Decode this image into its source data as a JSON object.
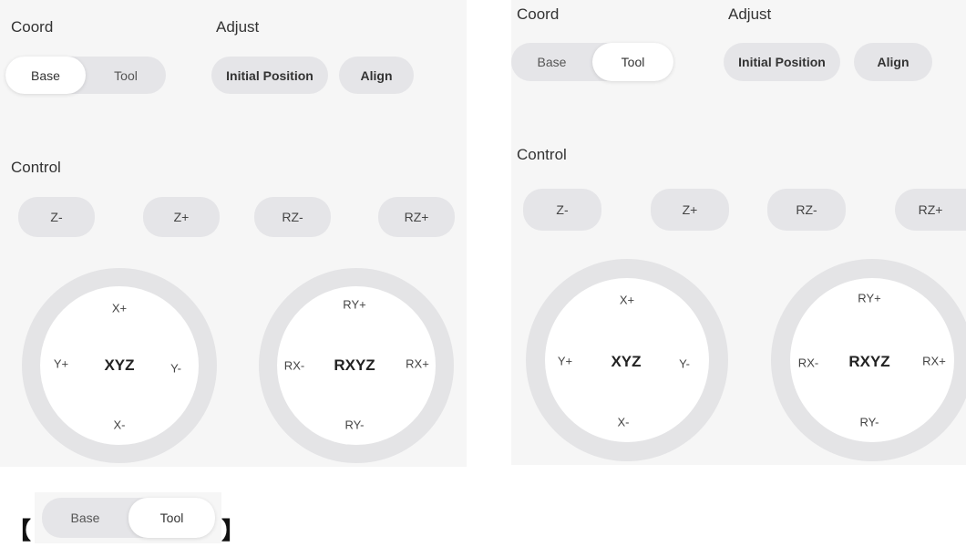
{
  "left_panel": {
    "coord_label": "Coord",
    "adjust_label": "Adjust",
    "coord_options": [
      {
        "label": "Base",
        "active": true
      },
      {
        "label": "Tool",
        "active": false
      }
    ],
    "adjust_buttons": [
      "Initial Position",
      "Align"
    ],
    "control_label": "Control",
    "control_buttons": [
      "Z-",
      "Z+",
      "RZ-",
      "RZ+"
    ],
    "xyz_pad": {
      "center": "XYZ",
      "up": "X+",
      "down": "X-",
      "left": "Y+",
      "right": "Y-"
    },
    "rxyz_pad": {
      "center": "RXYZ",
      "up": "RY+",
      "down": "RY-",
      "left": "RX-",
      "right": "RX+"
    }
  },
  "right_panel": {
    "coord_label": "Coord",
    "adjust_label": "Adjust",
    "coord_options": [
      {
        "label": "Base",
        "active": false
      },
      {
        "label": "Tool",
        "active": true
      }
    ],
    "adjust_buttons": [
      "Initial Position",
      "Align"
    ],
    "control_label": "Control",
    "control_buttons": [
      "Z-",
      "Z+",
      "RZ-",
      "RZ+"
    ],
    "xyz_pad": {
      "center": "XYZ",
      "up": "X+",
      "down": "X-",
      "left": "Y+",
      "right": "Y-"
    },
    "rxyz_pad": {
      "center": "RXYZ",
      "up": "RY+",
      "down": "RY-",
      "left": "RX-",
      "right": "RX+"
    }
  },
  "legend": {
    "open_bracket": "【",
    "close_bracket": "】",
    "coord_options": [
      {
        "label": "Base",
        "active": false
      },
      {
        "label": "Tool",
        "active": true
      }
    ]
  },
  "colors": {
    "panel_bg": "#f6f6f6",
    "control_bg": "#e5e5e8",
    "active_bg": "#ffffff",
    "ring": "#e4e4e6"
  }
}
